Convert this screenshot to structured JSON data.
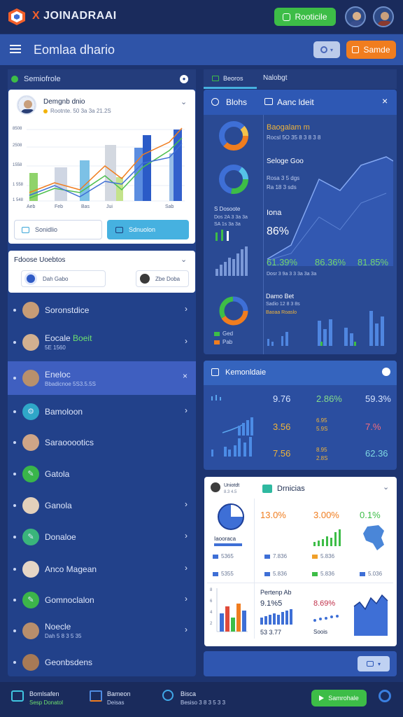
{
  "app": {
    "brand_prefix": "X",
    "brand": "JOINADRAAI"
  },
  "header": {
    "primary_button": "Rooticile",
    "title": "Eomlaa dhario",
    "secondary_button": "Samde"
  },
  "sidebar": {
    "title": "Semiofrole",
    "card1": {
      "name": "Demgnb dnio",
      "sub": "Rootnte. 50 3a 3a 21.2S",
      "ylabels": [
        "8508",
        "2508",
        "1558",
        "1 558",
        "1 548"
      ],
      "xlabels": [
        "Aeb",
        "Feb",
        "Bas",
        "Jui",
        "Sab"
      ],
      "btn_left": "Sonidlio",
      "btn_right": "Sdnuolon"
    },
    "card2": {
      "title": "Fdoose Uoebtos",
      "btn_left": "Dah Gabo",
      "btn_right": "Zbe Doba"
    },
    "items": [
      {
        "label": "Soronstdice",
        "sub": ""
      },
      {
        "label": "Eocale",
        "badge": "Boeit",
        "sub": "5E 1560"
      },
      {
        "label": "Eneloc",
        "sub": "Bbadicnoe 5S3.5.5S"
      },
      {
        "label": "Bamoloon",
        "sub": ""
      },
      {
        "label": "Saraooootics",
        "sub": ""
      },
      {
        "label": "Gatola",
        "sub": ""
      },
      {
        "label": "Ganola",
        "sub": ""
      },
      {
        "label": "Donaloe",
        "sub": ""
      },
      {
        "label": "Anco Magean",
        "sub": ""
      },
      {
        "label": "Gomnoclalon",
        "sub": ""
      },
      {
        "label": "Noecle",
        "sub": "Dah 5 8 3 5 35"
      },
      {
        "label": "Geonbsdens",
        "sub": ""
      }
    ]
  },
  "tabs": [
    "Beoros",
    "Nalobgt"
  ],
  "panel1": {
    "head_left": "Blohs",
    "head_right": "Aanc ldeit",
    "top_title": "Baogalam m",
    "top_sub": "Rocsl 5O 35 8 3 8 3 8",
    "mid_title": "Seloge Goo",
    "mid_rows": [
      "Rosa 3 5 dgs",
      "Ra 18 3 sds"
    ],
    "hero_label": "Iona",
    "hero_value": "86%",
    "left_sub_title": "S Dosoote",
    "left_sub_rows": [
      "Dos 2A 3 3a 3a",
      "SA 1s 3a 3a"
    ],
    "kpis": [
      "61.39%",
      "86.36%",
      "81.85%"
    ],
    "kpi_sub": "Dosr 3 9a 3 3 3a 3a 3a",
    "bottom_title": "Damo Bet",
    "bottom_sub": "Sadio 12 8 3 8s",
    "bottom_badge": "Baoaa Roaslo",
    "legend": [
      "Ged",
      "Pab"
    ]
  },
  "panel2": {
    "title": "Kemonldaie",
    "rows": [
      {
        "a": "9.76",
        "b": "2.86%",
        "c": "59.3%",
        "sub_b": ""
      },
      {
        "a": "3.56",
        "b": "6.95",
        "c": "7.%",
        "sub_b": "5.9S"
      },
      {
        "a": "7.56",
        "b": "8.95",
        "c": "62.36",
        "sub_b": "2.8S"
      }
    ]
  },
  "panel3": {
    "left_title": "Uniotdt",
    "left_sub": "8.3 4.5",
    "title": "Drnicias",
    "v1": "13.0%",
    "v2": "3.00%",
    "v3": "0.1%",
    "mini_label": "Iaooraca",
    "legend_left": [
      "5365",
      "5355"
    ],
    "legend_mid": [
      "7.836",
      "5.836"
    ],
    "legend_mid2": [
      "5.836",
      "5.836"
    ],
    "legend_right": [
      "7.8 36",
      "5.036"
    ],
    "row2_title": "Pertenp Ab",
    "row2_v1": "9.1%5",
    "row2_v2": "8.69%",
    "row2_legend": "53  3.77",
    "row2_legend2": "Soois",
    "axis": [
      "8",
      "6",
      "4",
      "2"
    ]
  },
  "bottom": {
    "items": [
      {
        "title": "Bomlsafen",
        "sub": "Sesp Donatol"
      },
      {
        "title": "Bameon",
        "sub": "Deisas"
      },
      {
        "title": "Bisca",
        "sub": "Besiso 3 8 3 5 3 3"
      }
    ],
    "button": "Samrohale"
  },
  "colors": {
    "bg": "#1d3470",
    "panel": "#2a4a94",
    "accent_green": "#3dbd47",
    "accent_orange": "#f07d1f",
    "accent_blue": "#3e6fd6"
  }
}
